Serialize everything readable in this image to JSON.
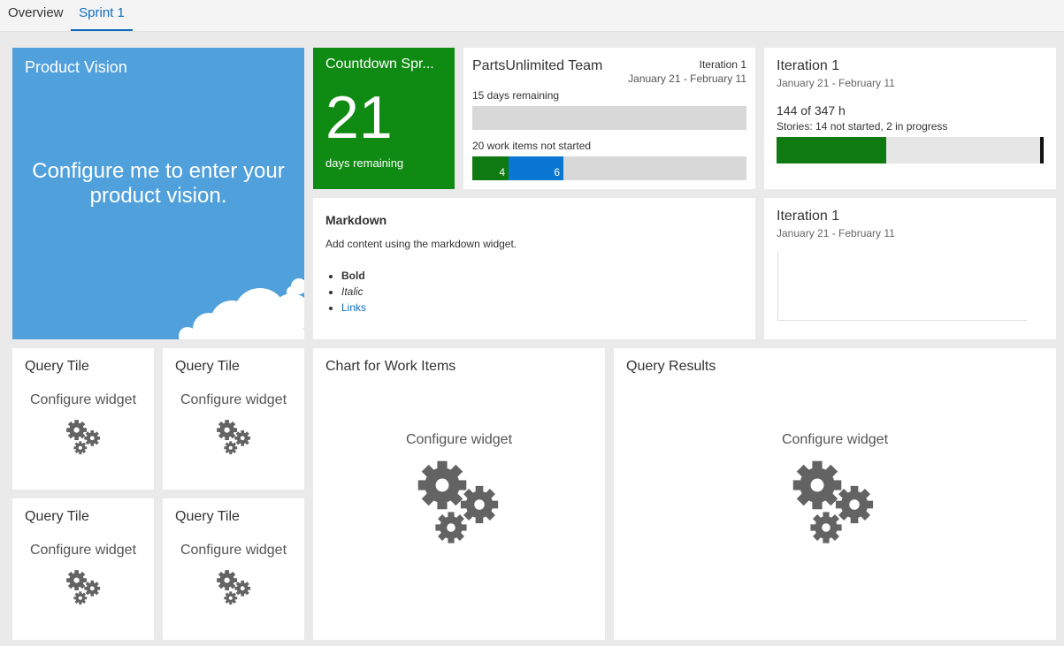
{
  "tabs": [
    {
      "label": "Overview"
    },
    {
      "label": "Sprint 1"
    }
  ],
  "vision": {
    "title": "Product Vision",
    "message": "Configure me to enter your product vision."
  },
  "countdown": {
    "title": "Countdown Spr...",
    "number": "21",
    "label": "days remaining"
  },
  "team": {
    "name": "PartsUnlimited Team",
    "iteration": "Iteration 1",
    "dates": "January 21 - February 11",
    "days_remaining": "15 days remaining",
    "days_progress": 0,
    "items_label": "20 work items not started",
    "segments": [
      {
        "value": "4",
        "color": "#0f7a12"
      },
      {
        "value": "6",
        "color": "#0a78d2"
      }
    ]
  },
  "iteration_burndown": {
    "title": "Iteration 1",
    "dates": "January 21 - February 11",
    "hours": "144 of 347 h",
    "stories": "Stories: 14 not started, 2 in progress",
    "fill_fraction": 0.41
  },
  "markdown": {
    "title": "Markdown",
    "text": "Add content using the markdown widget.",
    "bold": "Bold",
    "italic": "Italic",
    "link": "Links"
  },
  "iteration_chart": {
    "title": "Iteration 1",
    "dates": "January 21 - February 11"
  },
  "query_tiles": [
    {
      "title": "Query Tile",
      "config": "Configure widget"
    },
    {
      "title": "Query Tile",
      "config": "Configure widget"
    },
    {
      "title": "Query Tile",
      "config": "Configure widget"
    },
    {
      "title": "Query Tile",
      "config": "Configure widget"
    }
  ],
  "work_items_chart": {
    "title": "Chart for Work Items",
    "config": "Configure widget"
  },
  "query_results": {
    "title": "Query Results",
    "config": "Configure widget"
  },
  "icons": {
    "config": "gears-icon"
  },
  "colors": {
    "accent": "#106ebe",
    "vision_bg": "#50a0dc",
    "countdown_bg": "#0f8a12"
  }
}
